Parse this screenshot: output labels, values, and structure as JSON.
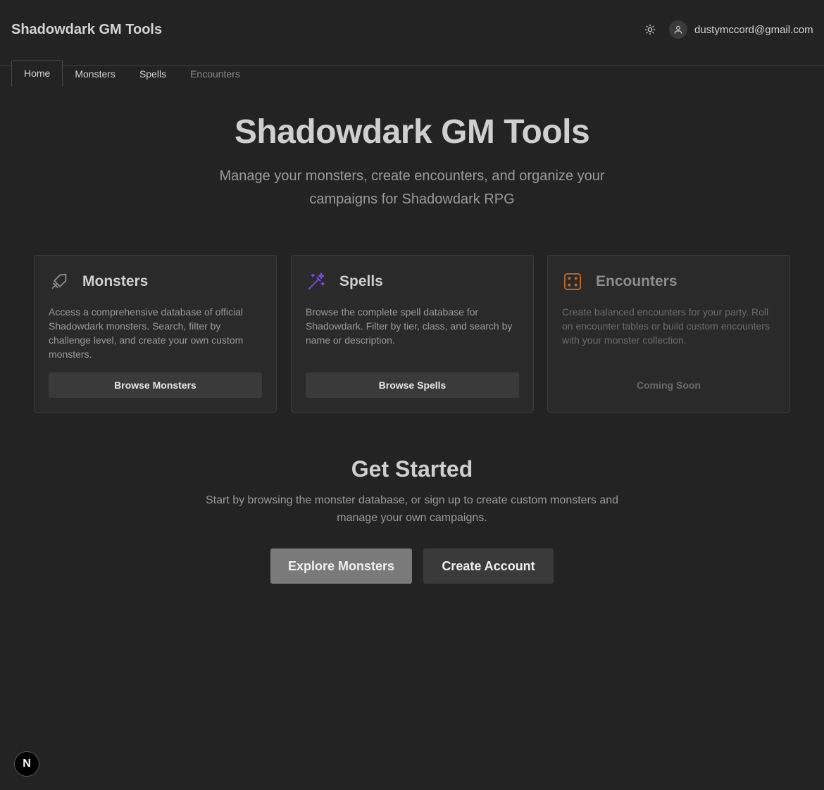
{
  "header": {
    "brand": "Shadowdark GM Tools",
    "theme_icon": "sun-icon",
    "user_icon": "user-icon",
    "user_email": "dustymccord@gmail.com"
  },
  "tabs": [
    {
      "label": "Home",
      "active": true
    },
    {
      "label": "Monsters"
    },
    {
      "label": "Spells"
    },
    {
      "label": "Encounters",
      "disabled": true
    }
  ],
  "hero": {
    "title": "Shadowdark GM Tools",
    "subtitle": "Manage your monsters, create encounters, and organize your campaigns for Shadowdark RPG"
  },
  "cards": [
    {
      "icon": "sword-icon",
      "title": "Monsters",
      "description": "Access a comprehensive database of official Shadowdark monsters. Search, filter by challenge level, and create your own custom monsters.",
      "button": "Browse Monsters"
    },
    {
      "icon": "magic-wand-icon",
      "icon_color": "#7c4ddb",
      "title": "Spells",
      "description": "Browse the complete spell database for Shadowdark. Filter by tier, class, and search by name or description.",
      "button": "Browse Spells"
    },
    {
      "icon": "dice-icon",
      "icon_color": "#b8692a",
      "title": "Encounters",
      "description": "Create balanced encounters for your party. Roll on encounter tables or build custom encounters with your monster collection.",
      "status": "Coming Soon"
    }
  ],
  "get_started": {
    "title": "Get Started",
    "subtitle": "Start by browsing the monster database, or sign up to create custom monsters and manage your own campaigns.",
    "primary_button": "Explore Monsters",
    "secondary_button": "Create Account"
  },
  "dev_badge": {
    "icon": "nextjs-icon",
    "letter": "N"
  }
}
